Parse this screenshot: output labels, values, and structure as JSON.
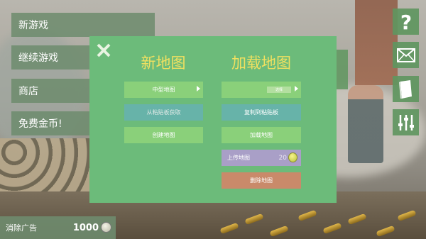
{
  "menu": {
    "new_game": "新游戏",
    "continue_game": "继续游戏",
    "shop": "商店",
    "free_coins": "免费金币!"
  },
  "remove_ads": {
    "label": "消除广告",
    "price": "1000"
  },
  "side_icons": [
    "help-icon",
    "mail-icon",
    "book-icon",
    "settings-sliders-icon"
  ],
  "dialog": {
    "new_map": {
      "title": "新地图",
      "size_select": "中型地图",
      "paste_from_clipboard": "从粘贴板获取",
      "create_map": "创建地图"
    },
    "load_map": {
      "title": "加载地图",
      "map_select_inner": "选择",
      "copy_to_clipboard": "复制到粘贴板",
      "load_map": "加载地图",
      "upload_map": "上传地图",
      "upload_cost": "20",
      "delete_map": "删除地图"
    }
  },
  "colors": {
    "dialog_bg": "#6cbb7a",
    "title_yellow": "#f0e060",
    "menu_green": "#6e8c6e"
  }
}
